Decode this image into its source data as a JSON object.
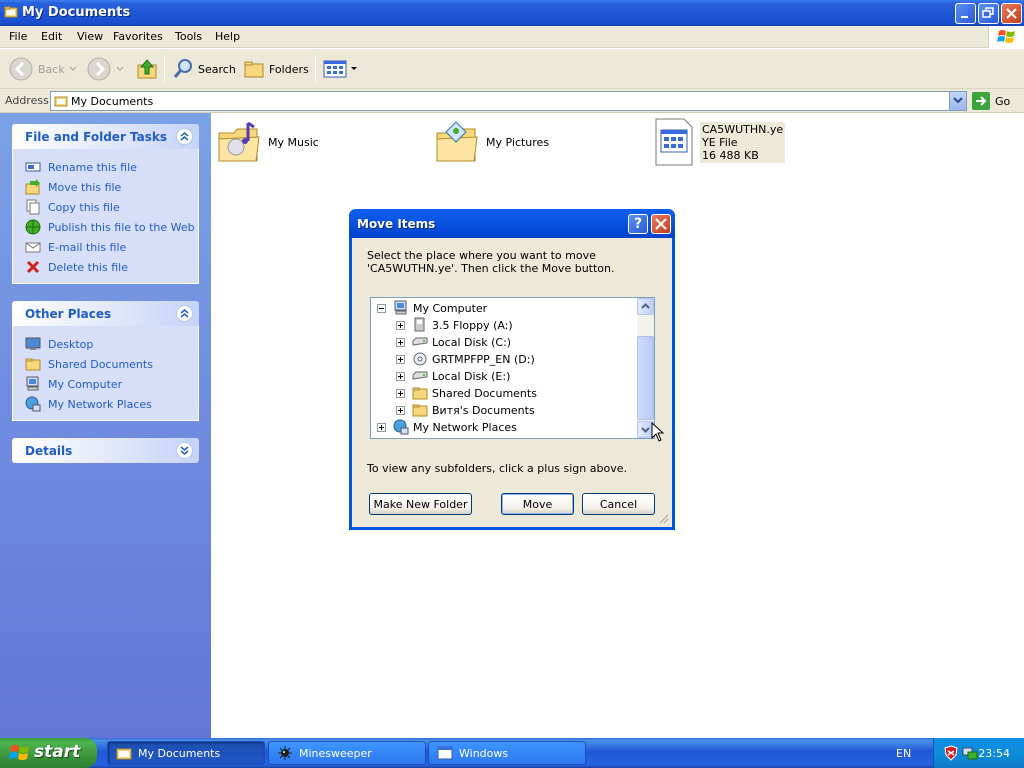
{
  "window": {
    "title": "My Documents"
  },
  "menu": [
    "File",
    "Edit",
    "View",
    "Favorites",
    "Tools",
    "Help"
  ],
  "toolbar": {
    "back": "Back",
    "search": "Search",
    "folders": "Folders"
  },
  "address": {
    "label": "Address",
    "value": "My Documents",
    "go": "Go"
  },
  "left_pane": {
    "file_tasks": {
      "title": "File and Folder Tasks",
      "items": [
        "Rename this file",
        "Move this file",
        "Copy this file",
        "Publish this file to the Web",
        "E-mail this file",
        "Delete this file"
      ]
    },
    "other_places": {
      "title": "Other Places",
      "items": [
        "Desktop",
        "Shared Documents",
        "My Computer",
        "My Network Places"
      ]
    },
    "details": {
      "title": "Details"
    }
  },
  "files": [
    {
      "name": "My Music"
    },
    {
      "name": "My Pictures"
    },
    {
      "name": "CA5WUTHN.ye",
      "type": "YE File",
      "size": "16 488 KB"
    }
  ],
  "dialog": {
    "title": "Move Items",
    "help": "?",
    "message": "Select the place where you want to move 'CA5WUTHN.ye'. Then click the Move button.",
    "tree": [
      "My Computer",
      "3.5 Floppy (A:)",
      "Local Disk (C:)",
      "GRTMPFPP_EN (D:)",
      "Local Disk (E:)",
      "Shared Documents",
      "Витя's Documents",
      "My Network Places"
    ],
    "hint": "To view any subfolders, click a plus sign above.",
    "buttons": {
      "new_folder": "Make New Folder",
      "move": "Move",
      "cancel": "Cancel"
    }
  },
  "taskbar": {
    "start": "start",
    "tasks": [
      "My Documents",
      "Minesweeper",
      "Windows"
    ],
    "lang": "EN",
    "clock": "23:54"
  }
}
